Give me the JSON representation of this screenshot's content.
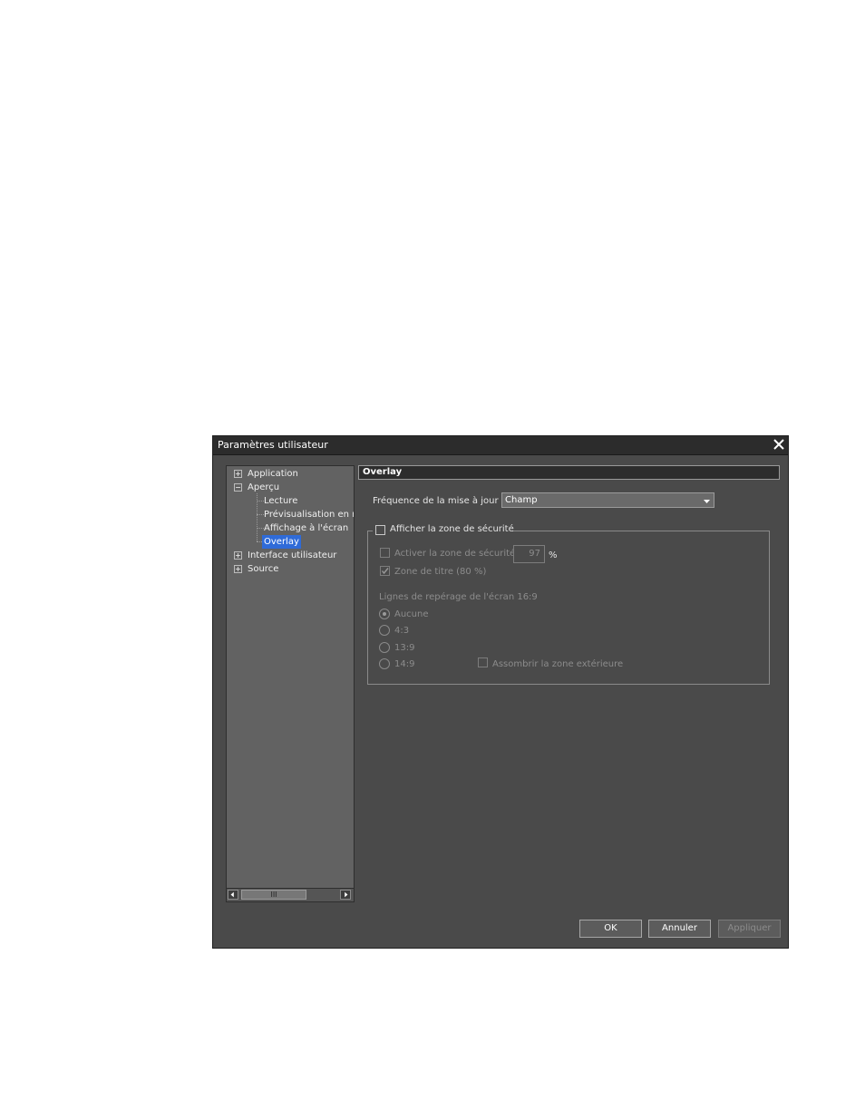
{
  "window": {
    "title": "Paramètres utilisateur"
  },
  "tree": {
    "items": [
      {
        "label": "Application",
        "expander": "+"
      },
      {
        "label": "Aperçu",
        "expander": "−"
      },
      {
        "label": "Lecture"
      },
      {
        "label": "Prévisualisation en mo"
      },
      {
        "label": "Affichage à l'écran"
      },
      {
        "label": "Overlay",
        "selected": true
      },
      {
        "label": "Interface utilisateur",
        "expander": "+"
      },
      {
        "label": "Source",
        "expander": "+"
      }
    ],
    "scroll_thumb": "III"
  },
  "panel": {
    "title": "Overlay",
    "update_frequency_label": "Fréquence de la mise à jour",
    "update_frequency_value": "Champ",
    "safe_zone_group": {
      "legend": "Afficher la zone de sécurité",
      "checked": false,
      "enable_safe_zone_label": "Activer la zone de sécurité",
      "safe_zone_value": "97",
      "percent_unit": "%",
      "title_zone_label": "Zone de titre (80 %)",
      "title_zone_checked": true,
      "guides_label": "Lignes de repérage de l'écran 16:9",
      "guide_options": [
        "Aucune",
        "4:3",
        "13:9",
        "14:9"
      ],
      "guide_selected": "Aucune",
      "darken_outside_label": "Assombrir la zone extérieure"
    }
  },
  "buttons": {
    "ok": "OK",
    "cancel": "Annuler",
    "apply": "Appliquer"
  },
  "colors": {
    "dialog_bg": "#4a4a4a",
    "selection": "#2f6bd8",
    "titlebar": "#2c2c2c"
  }
}
